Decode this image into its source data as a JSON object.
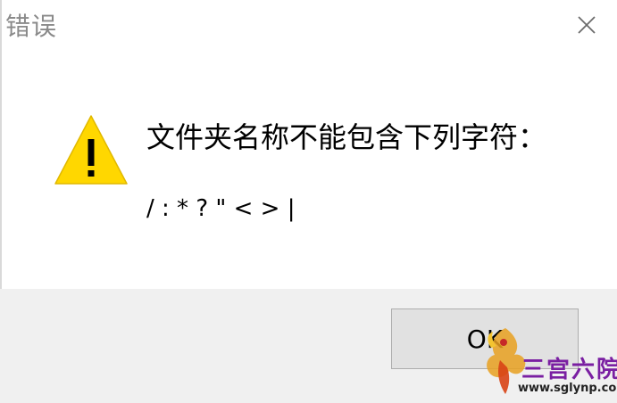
{
  "window": {
    "title": "错误",
    "close_icon": "close-icon"
  },
  "message": {
    "icon": "warning-icon",
    "icon_color": "#FFD700",
    "text": "文件夹名称不能包含下列字符：",
    "invalid_chars": "/ : * ? \" < > |"
  },
  "footer": {
    "ok_label": "OK"
  },
  "watermark": {
    "brand_text": "三宫六院",
    "url": "www.sglynp.com"
  }
}
